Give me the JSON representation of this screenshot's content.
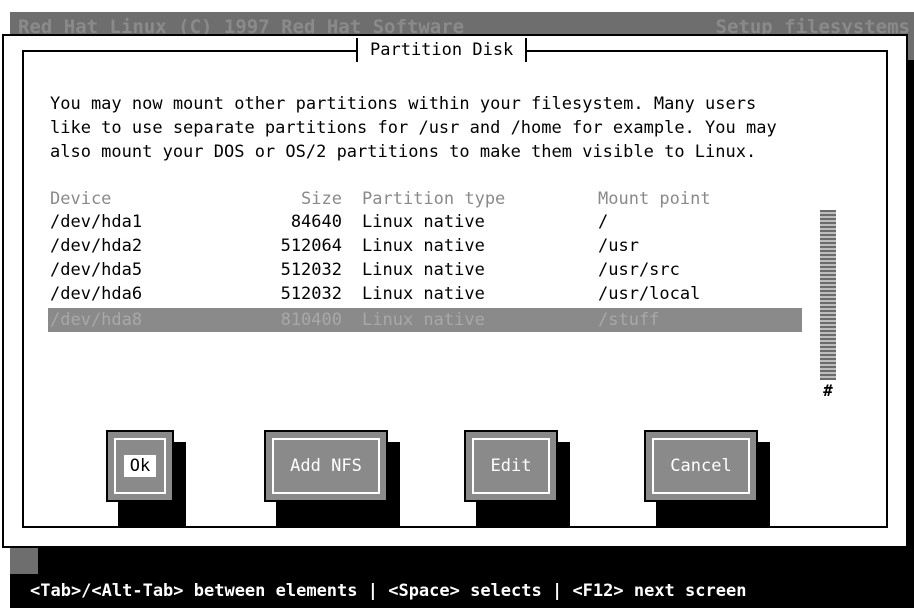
{
  "topbar": {
    "left": "Red Hat Linux (C) 1997 Red Hat Software",
    "right": "Setup filesystems"
  },
  "dialog": {
    "title": "Partition Disk",
    "intro_lines": [
      "You may now mount other partitions within your filesystem. Many users",
      "like to use separate partitions for /usr and /home for example. You may",
      "also mount your DOS or OS/2 partitions to make them visible to Linux."
    ]
  },
  "table": {
    "headers": {
      "device": "Device",
      "size": "Size",
      "type": "Partition type",
      "mount": "Mount point"
    },
    "rows": [
      {
        "device": "/dev/hda1",
        "size": "84640",
        "type": "Linux native",
        "mount": "/"
      },
      {
        "device": "/dev/hda2",
        "size": "512064",
        "type": "Linux native",
        "mount": "/usr"
      },
      {
        "device": "/dev/hda5",
        "size": "512032",
        "type": "Linux native",
        "mount": "/usr/src"
      },
      {
        "device": "/dev/hda6",
        "size": "512032",
        "type": "Linux native",
        "mount": "/usr/local"
      },
      {
        "device": "/dev/hda8",
        "size": "810400",
        "type": "Linux native",
        "mount": "/stuff",
        "selected": true
      }
    ],
    "scroll_marker": "#"
  },
  "buttons": {
    "ok": "Ok",
    "add_nfs": "Add NFS",
    "edit": "Edit",
    "cancel": "Cancel"
  },
  "statusbar": {
    "text": "<Tab>/<Alt-Tab> between elements   |  <Space> selects   |  <F12> next screen"
  },
  "colors": {
    "background": "#6e6e6e",
    "dialog": "#ffffff",
    "selected_row": "#8a8a8a",
    "button": "#8a8a8a"
  }
}
